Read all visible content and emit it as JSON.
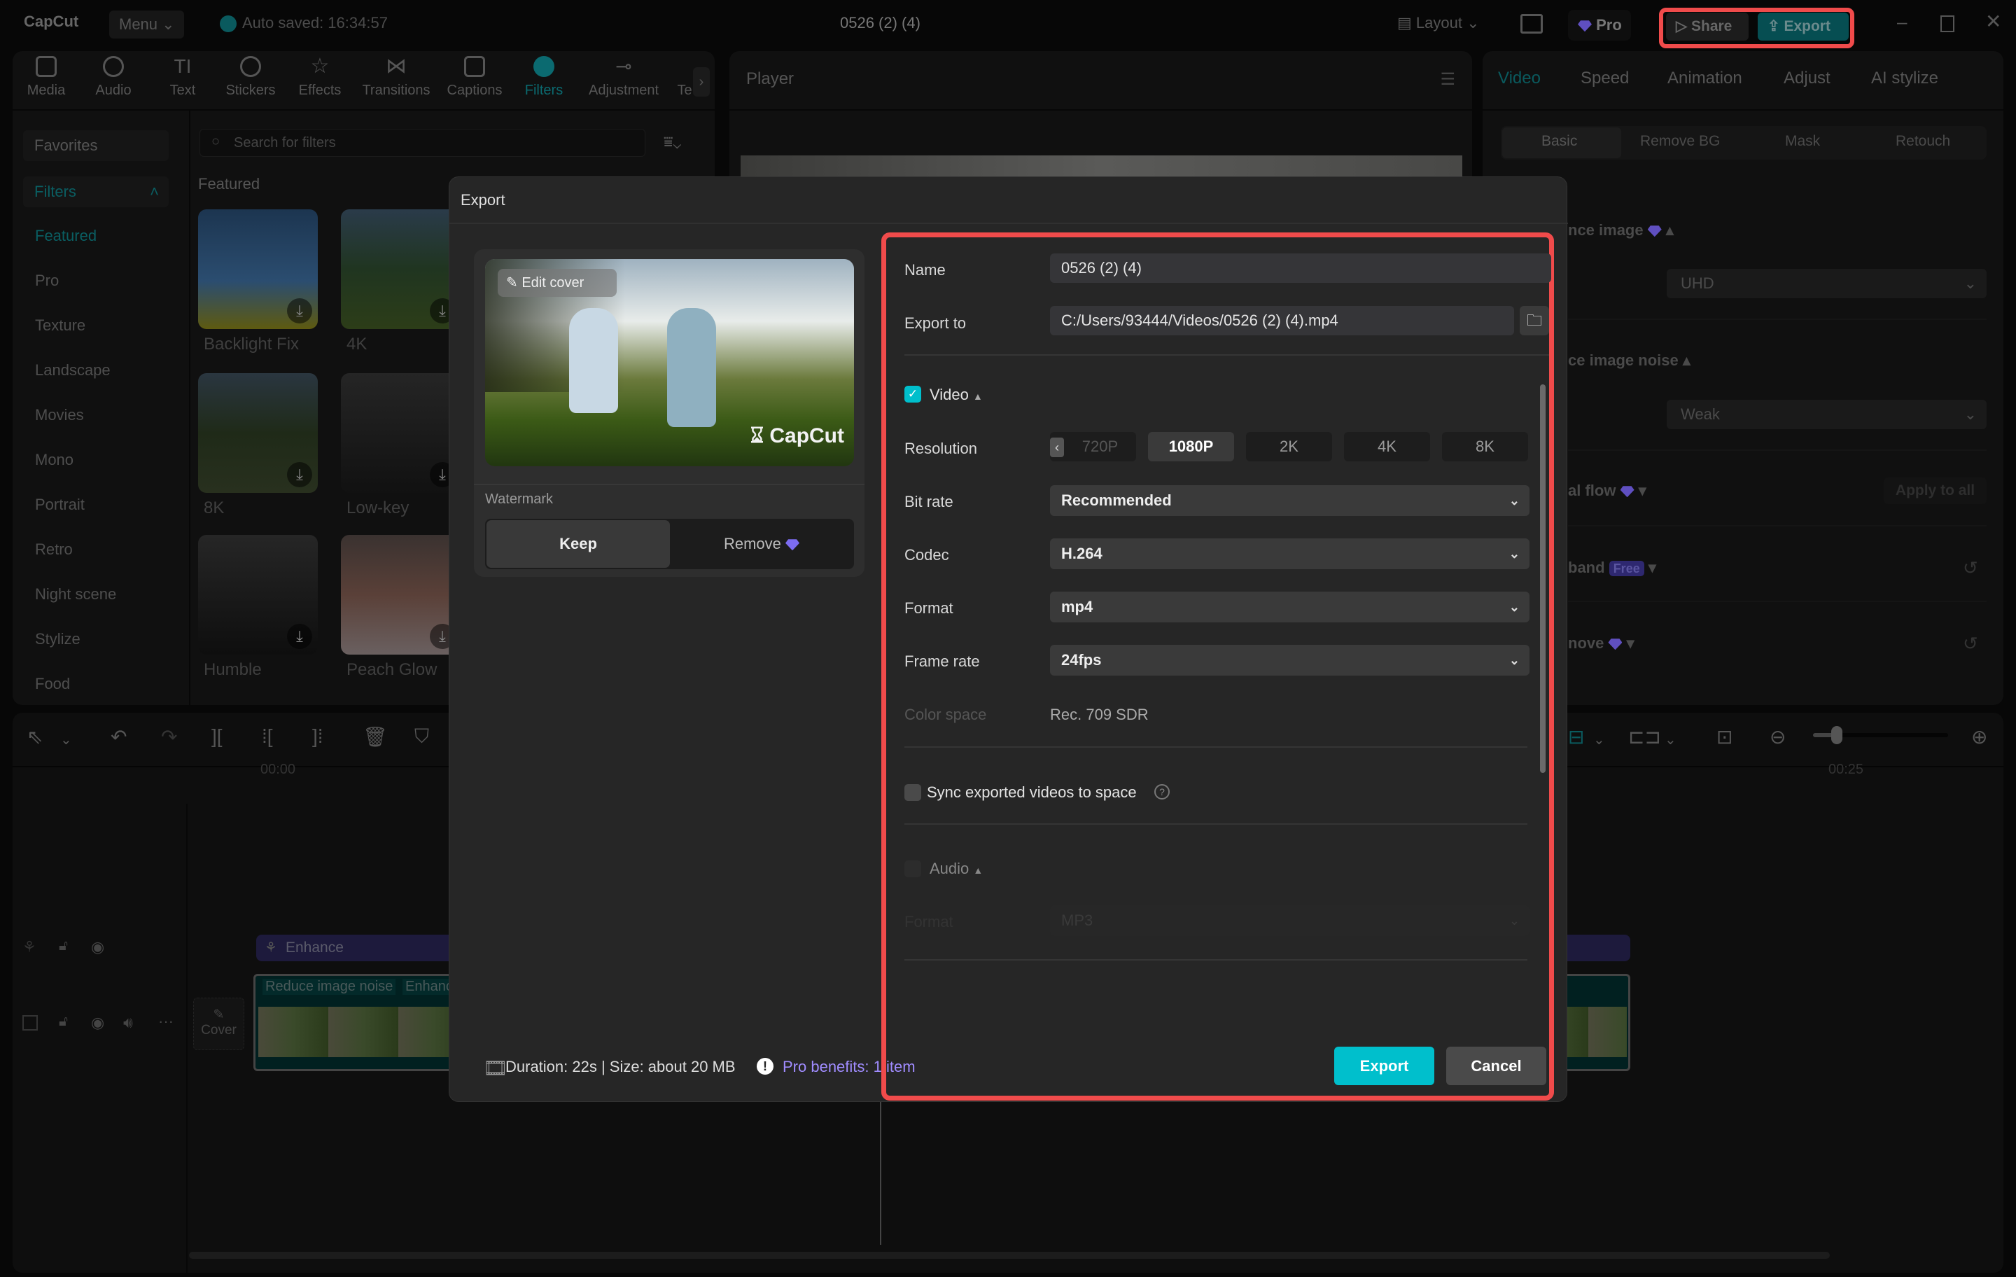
{
  "titlebar": {
    "app": "CapCut",
    "menu": "Menu",
    "autosave": "Auto saved: 16:34:57",
    "project_title": "0526 (2) (4)",
    "layout": "Layout",
    "pro": "Pro",
    "share": "Share",
    "export": "Export"
  },
  "toolbar": [
    "Media",
    "Audio",
    "Text",
    "Stickers",
    "Effects",
    "Transitions",
    "Captions",
    "Filters",
    "Adjustment",
    "Te"
  ],
  "sidebar": {
    "favorites": "Favorites",
    "filters": "Filters",
    "items": [
      "Featured",
      "Pro",
      "Texture",
      "Landscape",
      "Movies",
      "Mono",
      "Portrait",
      "Retro",
      "Night scene",
      "Stylize",
      "Food"
    ]
  },
  "filters": {
    "search_placeholder": "Search for filters",
    "section": "Featured",
    "items": [
      "Backlight Fix",
      "4K",
      "8K",
      "Low-key",
      "Humble",
      "Peach Glow"
    ]
  },
  "player": {
    "title": "Player"
  },
  "right_panel": {
    "tabs": [
      "Video",
      "Speed",
      "Animation",
      "Adjust",
      "AI stylize"
    ],
    "subtabs": [
      "Basic",
      "Remove BG",
      "Mask",
      "Retouch"
    ],
    "rows": [
      "nce image",
      "ce image noise",
      "al flow",
      "band",
      "nove"
    ],
    "enhance_value": "UHD",
    "noise_value": "Weak",
    "apply_all": "Apply to all",
    "free_badge": "Free"
  },
  "timeline": {
    "t0": "00:00",
    "t25": "00:25",
    "enhance_clip": "Enhance",
    "clip_tags": [
      "Reduce image noise",
      "Enhanc"
    ],
    "cover": "Cover"
  },
  "export_dialog": {
    "title": "Export",
    "edit_cover": "Edit cover",
    "watermark_brand": "CapCut",
    "watermark_label": "Watermark",
    "keep": "Keep",
    "remove": "Remove",
    "name_label": "Name",
    "name_value": "0526 (2) (4)",
    "export_to_label": "Export to",
    "export_to_value": "C:/Users/93444/Videos/0526 (2) (4).mp4",
    "video_label": "Video",
    "video_checked": true,
    "resolution_label": "Resolution",
    "resolutions": [
      "720P",
      "1080P",
      "2K",
      "4K",
      "8K"
    ],
    "resolution_selected": "1080P",
    "bitrate_label": "Bit rate",
    "bitrate_value": "Recommended",
    "codec_label": "Codec",
    "codec_value": "H.264",
    "format_label": "Format",
    "format_value": "mp4",
    "framerate_label": "Frame rate",
    "framerate_value": "24fps",
    "colorspace_label": "Color space",
    "colorspace_value": "Rec. 709 SDR",
    "sync_label": "Sync exported videos to space",
    "sync_checked": false,
    "audio_label": "Audio",
    "audio_format_label": "Format",
    "audio_format_value": "MP3",
    "summary": "Duration: 22s | Size: about 20 MB",
    "pro_benefits": "Pro benefits: 1 item",
    "export_button": "Export",
    "cancel_button": "Cancel"
  },
  "colors": {
    "accent": "#00bfcc",
    "highlight": "#f04b4b",
    "pro": "#a08cff"
  }
}
